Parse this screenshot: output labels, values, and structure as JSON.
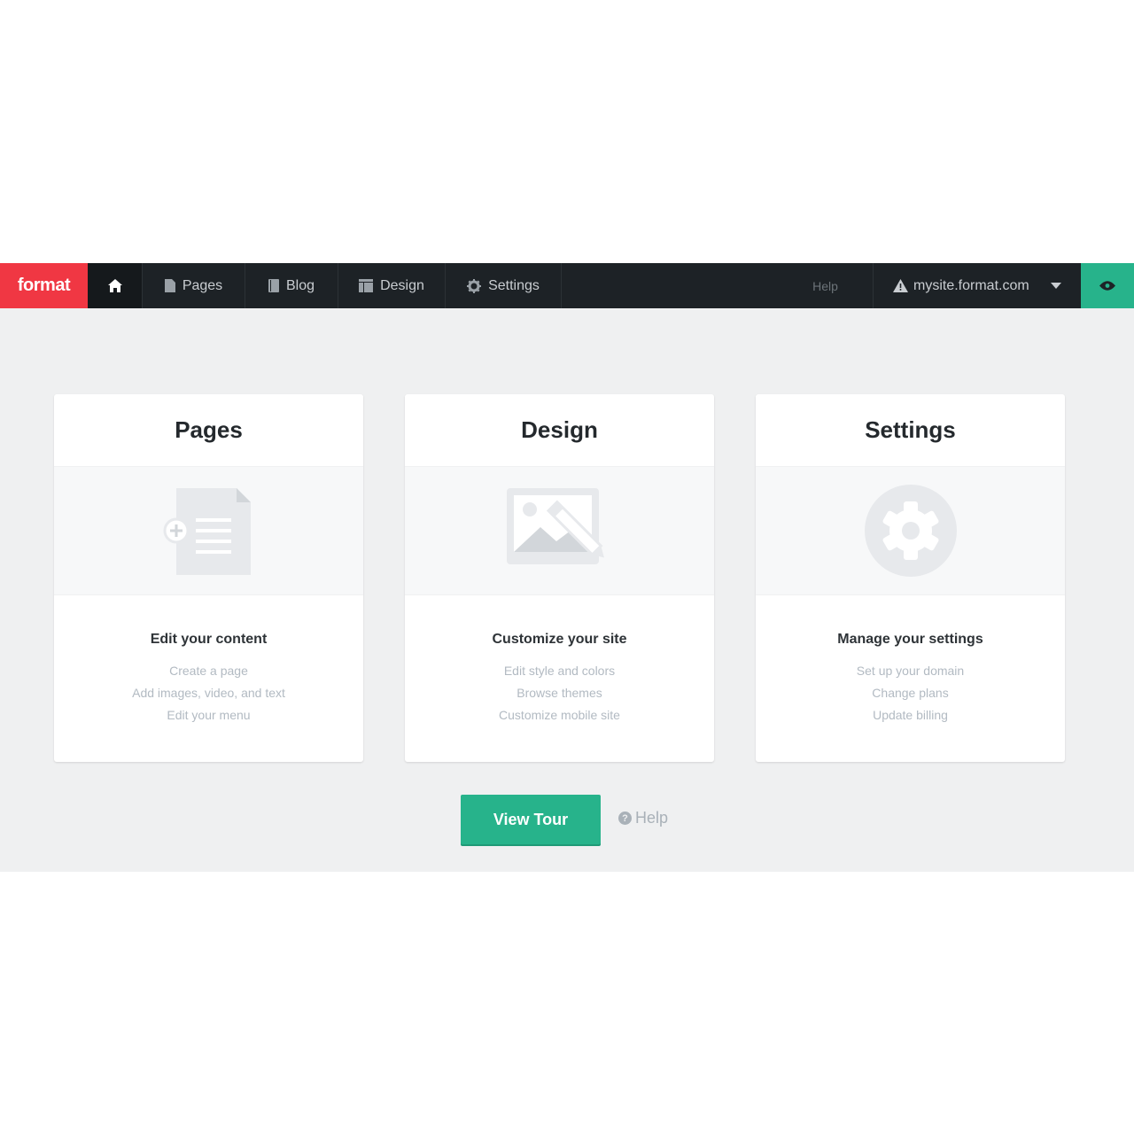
{
  "topbar": {
    "logo": "format",
    "nav": [
      {
        "label": "Pages",
        "icon": "page-icon"
      },
      {
        "label": "Blog",
        "icon": "book-icon"
      },
      {
        "label": "Design",
        "icon": "layout-icon"
      },
      {
        "label": "Settings",
        "icon": "gear-icon"
      }
    ],
    "help_label": "Help",
    "site_name": "mysite.format.com",
    "colors": {
      "logo_bg": "#f03743",
      "bar_bg": "#1d2226",
      "preview_bg": "#27b38b"
    }
  },
  "cards": [
    {
      "title": "Pages",
      "subtitle": "Edit your content",
      "links": [
        "Create a page",
        "Add images, video, and text",
        "Edit your menu"
      ]
    },
    {
      "title": "Design",
      "subtitle": "Customize your site",
      "links": [
        "Edit style and colors",
        "Browse themes",
        "Customize mobile site"
      ]
    },
    {
      "title": "Settings",
      "subtitle": "Manage your settings",
      "links": [
        "Set up your domain",
        "Change plans",
        "Update billing"
      ]
    }
  ],
  "actions": {
    "view_tour_label": "View Tour",
    "help_label": "Help",
    "accent": "#27b38b"
  }
}
